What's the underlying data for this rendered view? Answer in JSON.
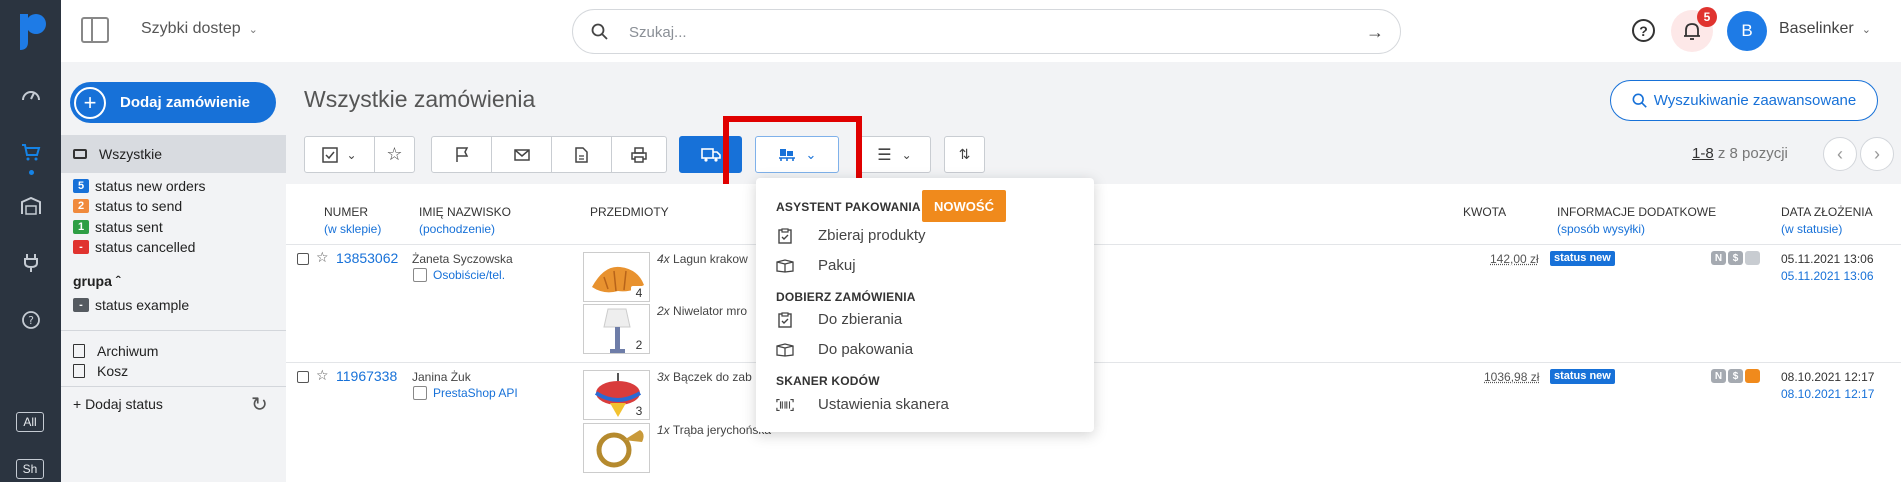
{
  "topbar": {
    "quick_access": "Szybki dostep",
    "search_placeholder": "Szukaj...",
    "notifications_count": "5",
    "avatar_initial": "B",
    "user_name": "Baselinker"
  },
  "rail": {
    "shortcut_all": "All",
    "shortcut_sh": "Sh"
  },
  "sidebar": {
    "add_order": "Dodaj zamówienie",
    "all": "Wszystkie",
    "statuses": [
      {
        "count": "5",
        "label": "status new orders",
        "color": "#1771d8"
      },
      {
        "count": "2",
        "label": "status to send",
        "color": "#f08a3c"
      },
      {
        "count": "1",
        "label": "status sent",
        "color": "#2e9e44"
      },
      {
        "count": "-",
        "label": "status cancelled",
        "color": "#e0332f"
      }
    ],
    "group_label": "grupa",
    "group_status": {
      "count": "-",
      "label": "status example",
      "color": "#555a60"
    },
    "archive": "Archiwum",
    "trash": "Kosz",
    "add_status": "+ Dodaj status"
  },
  "main": {
    "title": "Wszystkie zamówienia",
    "advanced_search": "Wyszukiwanie zaawansowane",
    "pager_range": "1-8",
    "pager_total": " z 8 pozycji"
  },
  "table": {
    "headers": {
      "number": "NUMER",
      "number_sub": "(w sklepie)",
      "name": "IMIĘ NAZWISKO",
      "name_sub": "(pochodzenie)",
      "items": "PRZEDMIOTY",
      "amount": "KWOTA",
      "info": "INFORMACJE DODATKOWE",
      "info_sub": "(sposób wysyłki)",
      "date": "DATA ZŁOŻENIA",
      "date_sub": "(w statusie)"
    },
    "rows": [
      {
        "id": "13853062",
        "customer": "Żaneta Syczowska",
        "source": "Osobiście/tel.",
        "items": [
          {
            "qty_prefix": "4x",
            "name": "Lagun krakow",
            "qty": "4"
          },
          {
            "qty_prefix": "2x",
            "name": "Niwelator mro",
            "qty": "2"
          }
        ],
        "amount": "142,00 zł",
        "status": "status new",
        "date": "05.11.2021 13:06",
        "status_date": "05.11.2021 13:06"
      },
      {
        "id": "11967338",
        "customer": "Janina Żuk",
        "source": "PrestaShop API",
        "items": [
          {
            "qty_prefix": "3x",
            "name": "Bączek do zab",
            "qty": "3"
          },
          {
            "qty_prefix": "1x",
            "name": "Trąba jerychońska",
            "qty": ""
          }
        ],
        "amount": "1036,98 zł",
        "status": "status new",
        "date": "08.10.2021 12:17",
        "status_date": "08.10.2021 12:17"
      }
    ],
    "mini_badges": [
      "N",
      "$"
    ]
  },
  "dropdown": {
    "packing_assistant": "ASYSTENT PAKOWANIA",
    "new_badge": "NOWOŚĆ",
    "collect_products": "Zbieraj produkty",
    "pack": "Pakuj",
    "pick_orders": "DOBIERZ ZAMÓWIENIA",
    "to_collect": "Do zbierania",
    "to_pack": "Do pakowania",
    "code_scanner": "SKANER KODÓW",
    "scanner_settings": "Ustawienia skanera"
  }
}
